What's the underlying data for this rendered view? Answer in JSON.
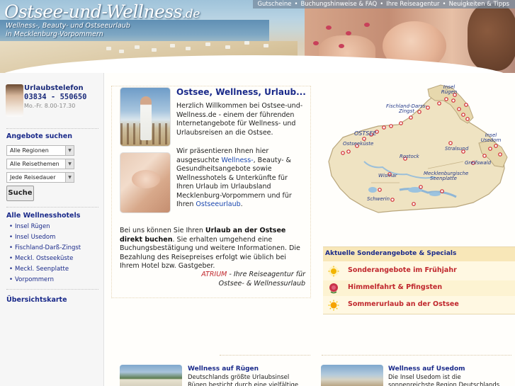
{
  "header": {
    "logo_title": "Ostsee-und-Wellness",
    "logo_tld": ".de",
    "logo_sub_line1": "Wellness-, Beauty- und Ostseeurlaub",
    "logo_sub_line2": "in Mecklenburg-Vorpommern",
    "topnav": [
      "Gutscheine",
      "Buchungshinweise & FAQ",
      "Ihre Reiseagentur",
      "Neuigkeiten & Tipps"
    ],
    "topnav_separator": "•"
  },
  "sidebar": {
    "hotline_label": "Urlaubstelefon",
    "hotline_phone": "03834 - 550650",
    "hotline_hours": "Mo.-Fr. 8.00-17.30",
    "search_heading": "Angebote suchen",
    "select_region": "Alle Regionen",
    "select_theme": "Alle Reisethemen",
    "select_duration": "Jede Reisedauer",
    "search_button": "Suche",
    "hotels_heading": "Alle Wellnesshotels",
    "hotel_links": [
      "Insel Rügen",
      "Insel Usedom",
      "Fischland-Darß-Zingst",
      "Meckl. Ostseeküste",
      "Meckl. Seenplatte",
      "Vorpommern"
    ],
    "overview_link": "Übersichtskarte"
  },
  "main": {
    "welcome_title": "Ostsee, Wellness, Urlaub...",
    "para1": "Herzlich Willkommen bei Ostsee-und-Wellness.de - einem der führenden Internetangebote für Wellness- und Urlaubsreisen an die Ostsee.",
    "para2_pre": "Wir präsentieren Ihnen hier ausgesuchte ",
    "para2_link1": "Wellness-",
    "para2_mid": ", Beauty- & Gesundheitsangebote sowie Wellnesshotels & Unterkünfte für Ihren Urlaub im Urlaubsland Mecklenburg-Vorpommern und für Ihren ",
    "para2_link2": "Ostseeurlaub",
    "para2_end": ".",
    "para3_pre": "Bei uns können Sie Ihren ",
    "para3_bold": "Urlaub an der Ostsee direkt buchen",
    "para3_post": ". Sie erhalten umgehend eine Buchungsbestätigung und weitere Informationen. Die Bezahlung des Reisepreises erfolgt wie üblich bei Ihrem Hotel bzw. Gastgeber.",
    "atrium_brand": "ATRIUM",
    "atrium_text": " - Ihre Reiseagentur für Ostsee- & Wellnessurlaub"
  },
  "map": {
    "labels": {
      "sea": "OSTSEE",
      "coast": "Ostseeküste",
      "ruegen": "Insel Rügen",
      "fischland": "Fischland-Darss-Zingst",
      "rostock": "Rostock",
      "stralsund": "Stralsund",
      "greifswald": "Greifswald",
      "usedom": "Insel Usedom",
      "wismar": "Wismar",
      "schwerin": "Schwerin",
      "seenplatte": "Mecklenburgische Seenplatte"
    }
  },
  "specials": {
    "heading": "Aktuelle Sonderangebote & Specials",
    "items": [
      {
        "label": "Sonderangebote im Frühjahr",
        "icon": "sun-flower-icon",
        "color": "#f2b400"
      },
      {
        "label": "Himmelfahrt & Pfingsten",
        "icon": "rose-icon",
        "color": "#c8324a"
      },
      {
        "label": "Sommerurlaub an der Ostsee",
        "icon": "sun-icon",
        "color": "#f5a300"
      }
    ]
  },
  "teasers": [
    {
      "title": "Wellness auf Rügen",
      "text": "Deutschlands größte Urlaubsinsel Rügen besticht durch eine vielfältige Landschaft"
    },
    {
      "title": "Wellness auf Usedom",
      "text": "Die Insel Usedom ist die sonnenreichste Region Deutschlands und besitzt die höchste"
    }
  ],
  "colors": {
    "accent_blue": "#1a2a8a",
    "accent_red": "#c0272d",
    "specials_bg": "#fff8e2"
  }
}
